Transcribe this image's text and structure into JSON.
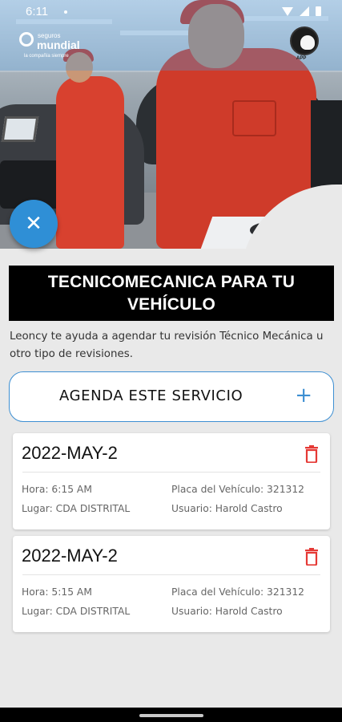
{
  "status_bar": {
    "time": "6:11"
  },
  "hero": {
    "logo": {
      "prefix": "seguros",
      "brand": "mundial",
      "tagline": "la compañía siempre"
    },
    "badge": {
      "text": "APP"
    }
  },
  "close_fab": {
    "glyph": "✕"
  },
  "header": {
    "title": "TECNICOMECANICA PARA TU VEHÍCULO",
    "description": "Leoncy te ayuda a agendar tu revisión Técnico Mecánica u otro tipo de revisiones."
  },
  "agenda_button": {
    "label": "AGENDA ESTE SERVICIO",
    "plus": "+"
  },
  "appointments": [
    {
      "date": "2022-MAY-2",
      "hora": "Hora: 6:15 AM",
      "lugar": "Lugar: CDA DISTRITAL",
      "placa": "Placa del Vehículo: 321312",
      "usuario": "Usuario: Harold Castro"
    },
    {
      "date": "2022-MAY-2",
      "hora": "Hora: 5:15 AM",
      "lugar": "Lugar: CDA DISTRITAL",
      "placa": "Placa del Vehículo: 321312",
      "usuario": "Usuario: Harold Castro"
    }
  ],
  "colors": {
    "accent": "#3d8fd2",
    "fab": "#2f8fd6",
    "delete": "#e53935",
    "title_bg": "#000000"
  }
}
